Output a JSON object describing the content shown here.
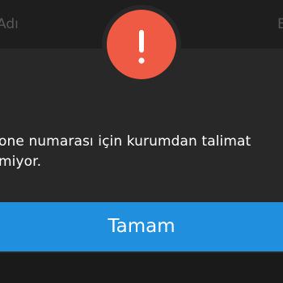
{
  "backdrop": {
    "left_text": "Adı",
    "right_text": "E"
  },
  "dialog": {
    "icon": "exclamation-alert-icon",
    "icon_color": "#ee5a44",
    "message_line1": "one numarası için kurumdan talimat",
    "message_line2": "miyor.",
    "ok_label": "Tamam",
    "ok_color": "#1f8fde"
  }
}
